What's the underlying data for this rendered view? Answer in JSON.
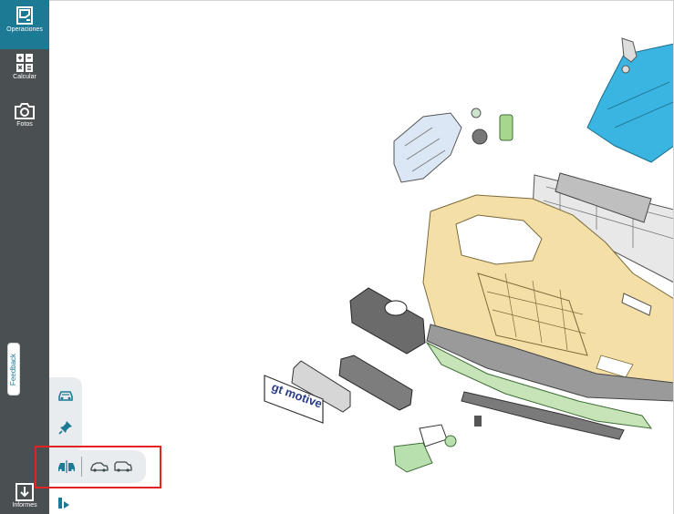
{
  "sidebar": {
    "items": [
      {
        "label": "Operaciones",
        "icon": "door-icon",
        "active": true
      },
      {
        "label": "Calcular",
        "icon": "calculator-icon",
        "active": false
      },
      {
        "label": "Fotos",
        "icon": "camera-icon",
        "active": false
      },
      {
        "label": "Informes",
        "icon": "download-icon",
        "active": false
      }
    ],
    "feedback_label": "Feedback"
  },
  "toolbar": {
    "buttons": [
      "car-view-icon",
      "pin-icon"
    ],
    "view_bar": [
      "split-car-icon",
      "car-side-icon",
      "van-side-icon"
    ]
  },
  "diagram": {
    "badge_text": "gt motive"
  },
  "colors": {
    "sidebar": "#4a4f52",
    "active": "#1c7a94",
    "bumper": "#f4dfa6",
    "fender": "#3ab4e0",
    "clip": "#b8dfae",
    "highlight": "#e32222"
  }
}
